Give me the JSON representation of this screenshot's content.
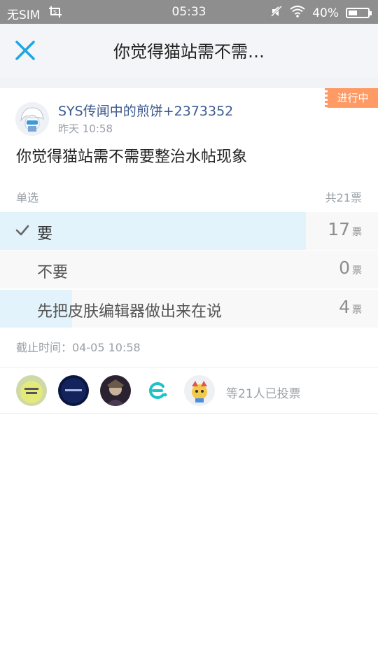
{
  "status_bar": {
    "carrier": "无SIM",
    "time": "05:33",
    "battery": "40%"
  },
  "header": {
    "title": "你觉得猫站需不需…"
  },
  "poll": {
    "badge": "进行中",
    "author": "SYS传闻中的煎饼+2373352",
    "timestamp": "昨天 10:58",
    "question": "你觉得猫站需不需要整治水帖现象",
    "mode": "单选",
    "total": "共21票",
    "options": [
      {
        "label": "要",
        "count": "17",
        "unit": "票",
        "share": 0.81,
        "selected": true
      },
      {
        "label": "不要",
        "count": "0",
        "unit": "票",
        "share": 0.0,
        "selected": false
      },
      {
        "label": "先把皮肤编辑器做出来在说",
        "count": "4",
        "unit": "票",
        "share": 0.19,
        "selected": false
      }
    ],
    "deadline": "截止时间：04-05 10:58",
    "voters_text": "等21人已投票"
  },
  "colors": {
    "accent": "#1fa6e0",
    "author": "#3c5a8e",
    "badge": "#ff9a64",
    "bar_fill": "#e3f3fb"
  }
}
